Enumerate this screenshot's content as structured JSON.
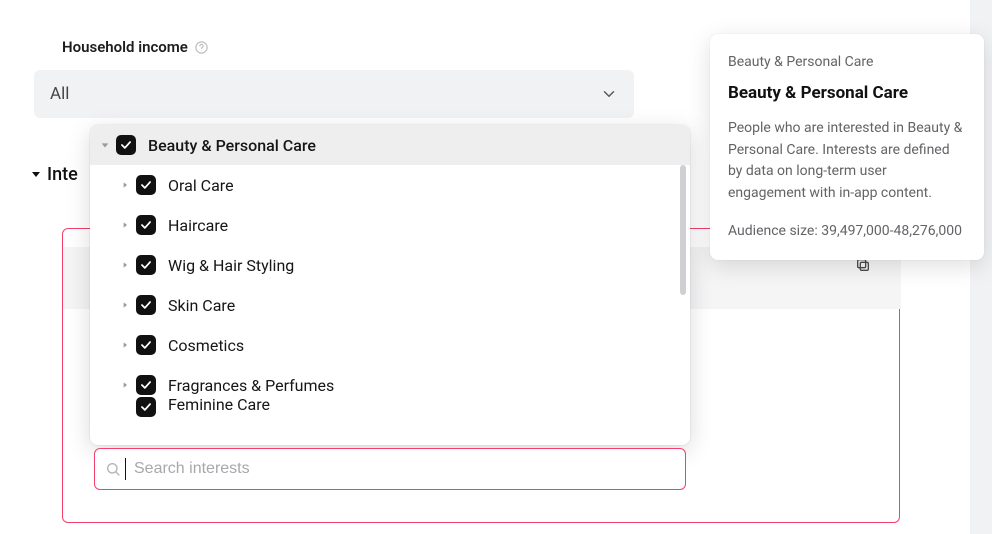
{
  "labels": {
    "household_income": "Household income",
    "section_interests_truncated": "Inte"
  },
  "household_income_select": {
    "value": "All"
  },
  "interests_dropdown": {
    "top": {
      "label": "Beauty & Personal Care",
      "checked": true,
      "expanded": true
    },
    "children": [
      {
        "label": "Oral Care",
        "checked": true
      },
      {
        "label": "Haircare",
        "checked": true
      },
      {
        "label": "Wig & Hair Styling",
        "checked": true
      },
      {
        "label": "Skin Care",
        "checked": true
      },
      {
        "label": "Cosmetics",
        "checked": true
      },
      {
        "label": "Fragrances & Perfumes",
        "checked": true
      },
      {
        "label": "Feminine Care",
        "checked": true
      }
    ],
    "search_placeholder": "Search interests"
  },
  "info_panel": {
    "breadcrumb": "Beauty & Personal Care",
    "title": "Beauty & Personal Care",
    "description": "People who are interested in Beauty & Personal Care. Interests are defined by data on long-term user engagement with in-app content.",
    "audience_size_label": "Audience size: 39,497,000-48,276,000"
  },
  "icons": {
    "help": "help-circle-icon",
    "chevron_down": "chevron-down-icon",
    "chevron_right": "chevron-right-icon",
    "check": "check-icon",
    "search": "search-icon",
    "copy": "copy-icon",
    "caret_down_solid": "caret-down-solid-icon",
    "caret_right_solid": "caret-right-solid-icon"
  },
  "colors": {
    "accent_focus": "#f53f6d",
    "checkbox_bg": "#111111",
    "panel_muted_text": "#636367"
  }
}
